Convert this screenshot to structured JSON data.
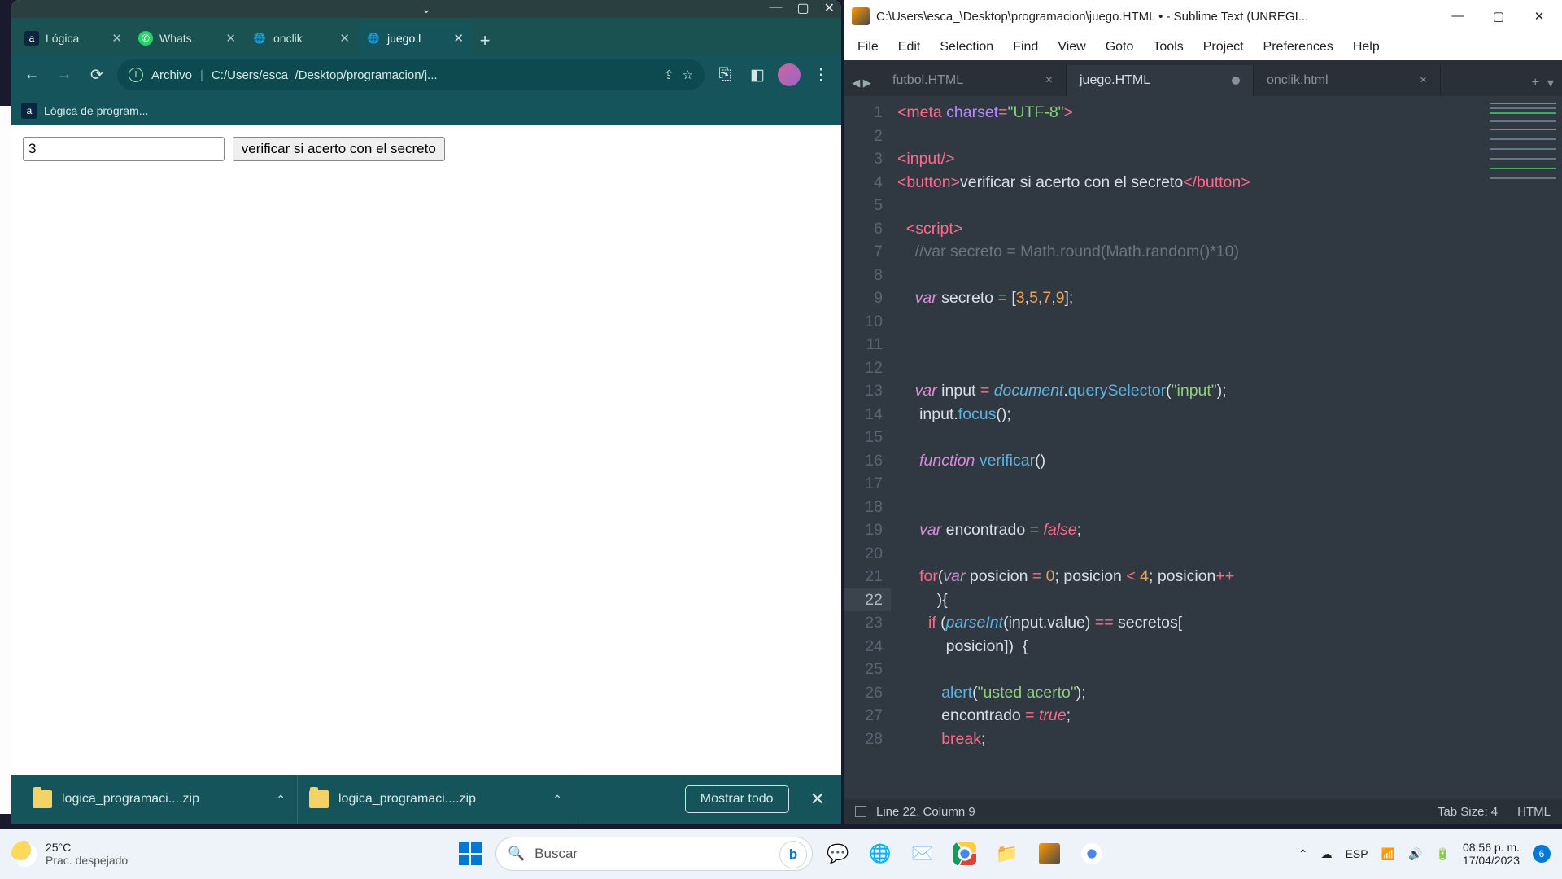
{
  "browser": {
    "tabs": [
      {
        "label": "Lógica",
        "icon": "alura"
      },
      {
        "label": "Whats",
        "icon": "wa"
      },
      {
        "label": "onclik",
        "icon": "globe"
      },
      {
        "label": "juego.l",
        "icon": "globe",
        "active": true
      }
    ],
    "address": {
      "scheme": "Archivo",
      "path": "C:/Users/esca_/Desktop/programacion/j..."
    },
    "bookmark": "Lógica de program...",
    "page": {
      "input_value": "3",
      "button_label": "verificar si acerto con el secreto"
    },
    "downloads": {
      "item1": "logica_programaci....zip",
      "item2": "logica_programaci....zip",
      "show_all": "Mostrar todo"
    }
  },
  "sublime": {
    "title": "C:\\Users\\esca_\\Desktop\\programacion\\juego.HTML • - Sublime Text (UNREGI...",
    "menu": [
      "File",
      "Edit",
      "Selection",
      "Find",
      "View",
      "Goto",
      "Tools",
      "Project",
      "Preferences",
      "Help"
    ],
    "tabs": [
      {
        "label": "futbol.HTML",
        "active": false,
        "dirty": false
      },
      {
        "label": "juego.HTML",
        "active": true,
        "dirty": true
      },
      {
        "label": "onclik.html",
        "active": false,
        "dirty": false
      }
    ],
    "status": {
      "pos": "Line 22, Column 9",
      "tabsize": "Tab Size: 4",
      "syntax": "HTML"
    },
    "code_lines": [
      "1",
      "2",
      "3",
      "4",
      "5",
      "6",
      "7",
      "8",
      "9",
      "10",
      "11",
      "12",
      "13",
      "14",
      "15",
      "16",
      "17",
      "18",
      "19",
      "20",
      "21",
      "22",
      "23",
      "24",
      "25",
      "26",
      "27",
      "28"
    ],
    "current_line": "22",
    "code": {
      "l1a": "<",
      "l1b": "meta",
      "l1c": " ",
      "l1d": "charset",
      "l1e": "=",
      "l1f": "\"UTF-8\"",
      "l1g": ">",
      "l3a": "<",
      "l3b": "input",
      "l3c": "/>",
      "l4a": "<",
      "l4b": "button",
      "l4c": ">",
      "l4d": "verificar si acerto con el secreto",
      "l4e": "</",
      "l4f": "button",
      "l4g": ">",
      "l6a": "  <",
      "l6b": "script",
      "l6c": ">",
      "l7": "    //var secreto = Math.round(Math.random()*10)",
      "l9a": "    ",
      "l9b": "var",
      "l9c": " secreto ",
      "l9d": "=",
      "l9e": " [",
      "l9f": "3",
      "l9g": ",",
      "l9h": "5",
      "l9i": ",",
      "l9j": "7",
      "l9k": ",",
      "l9l": "9",
      "l9m": "];",
      "l13a": "    ",
      "l13b": "var",
      "l13c": " input ",
      "l13d": "=",
      "l13e": " ",
      "l13f": "document",
      "l13g": ".",
      "l13h": "querySelector",
      "l13i": "(",
      "l13j": "\"input\"",
      "l13k": ");",
      "l14a": "     input.",
      "l14b": "focus",
      "l14c": "();",
      "l16a": "     ",
      "l16b": "function",
      "l16c": " ",
      "l16d": "verificar",
      "l16e": "()",
      "l19a": "     ",
      "l19b": "var",
      "l19c": " encontrado ",
      "l19d": "=",
      "l19e": " ",
      "l19f": "false",
      "l19g": ";",
      "l21a": "     ",
      "l21b": "for",
      "l21c": "(",
      "l21d": "var",
      "l21e": " posicion ",
      "l21f": "=",
      "l21g": " ",
      "l21h": "0",
      "l21i": "; posicion ",
      "l21j": "<",
      "l21k": " ",
      "l21l": "4",
      "l21m": "; posicion",
      "l21n": "++",
      "l21o": "         ){",
      "l23a": "       ",
      "l23b": "if",
      "l23c": " (",
      "l23d": "parseInt",
      "l23e": "(input.value) ",
      "l23f": "==",
      "l23g": " secretos[",
      "l23h": "           posicion])  {",
      "l25a": "          ",
      "l25b": "alert",
      "l25c": "(",
      "l25d": "\"usted acerto\"",
      "l25e": ");",
      "l26a": "          encontrado ",
      "l26b": "=",
      "l26c": " ",
      "l26d": "true",
      "l26e": ";",
      "l27a": "          ",
      "l27b": "break",
      "l27c": ";"
    }
  },
  "taskbar": {
    "weather_temp": "25°C",
    "weather_desc": "Prac. despejado",
    "search_placeholder": "Buscar",
    "lang": "ESP",
    "time": "08:56 p. m.",
    "date": "17/04/2023",
    "notif": "6"
  }
}
